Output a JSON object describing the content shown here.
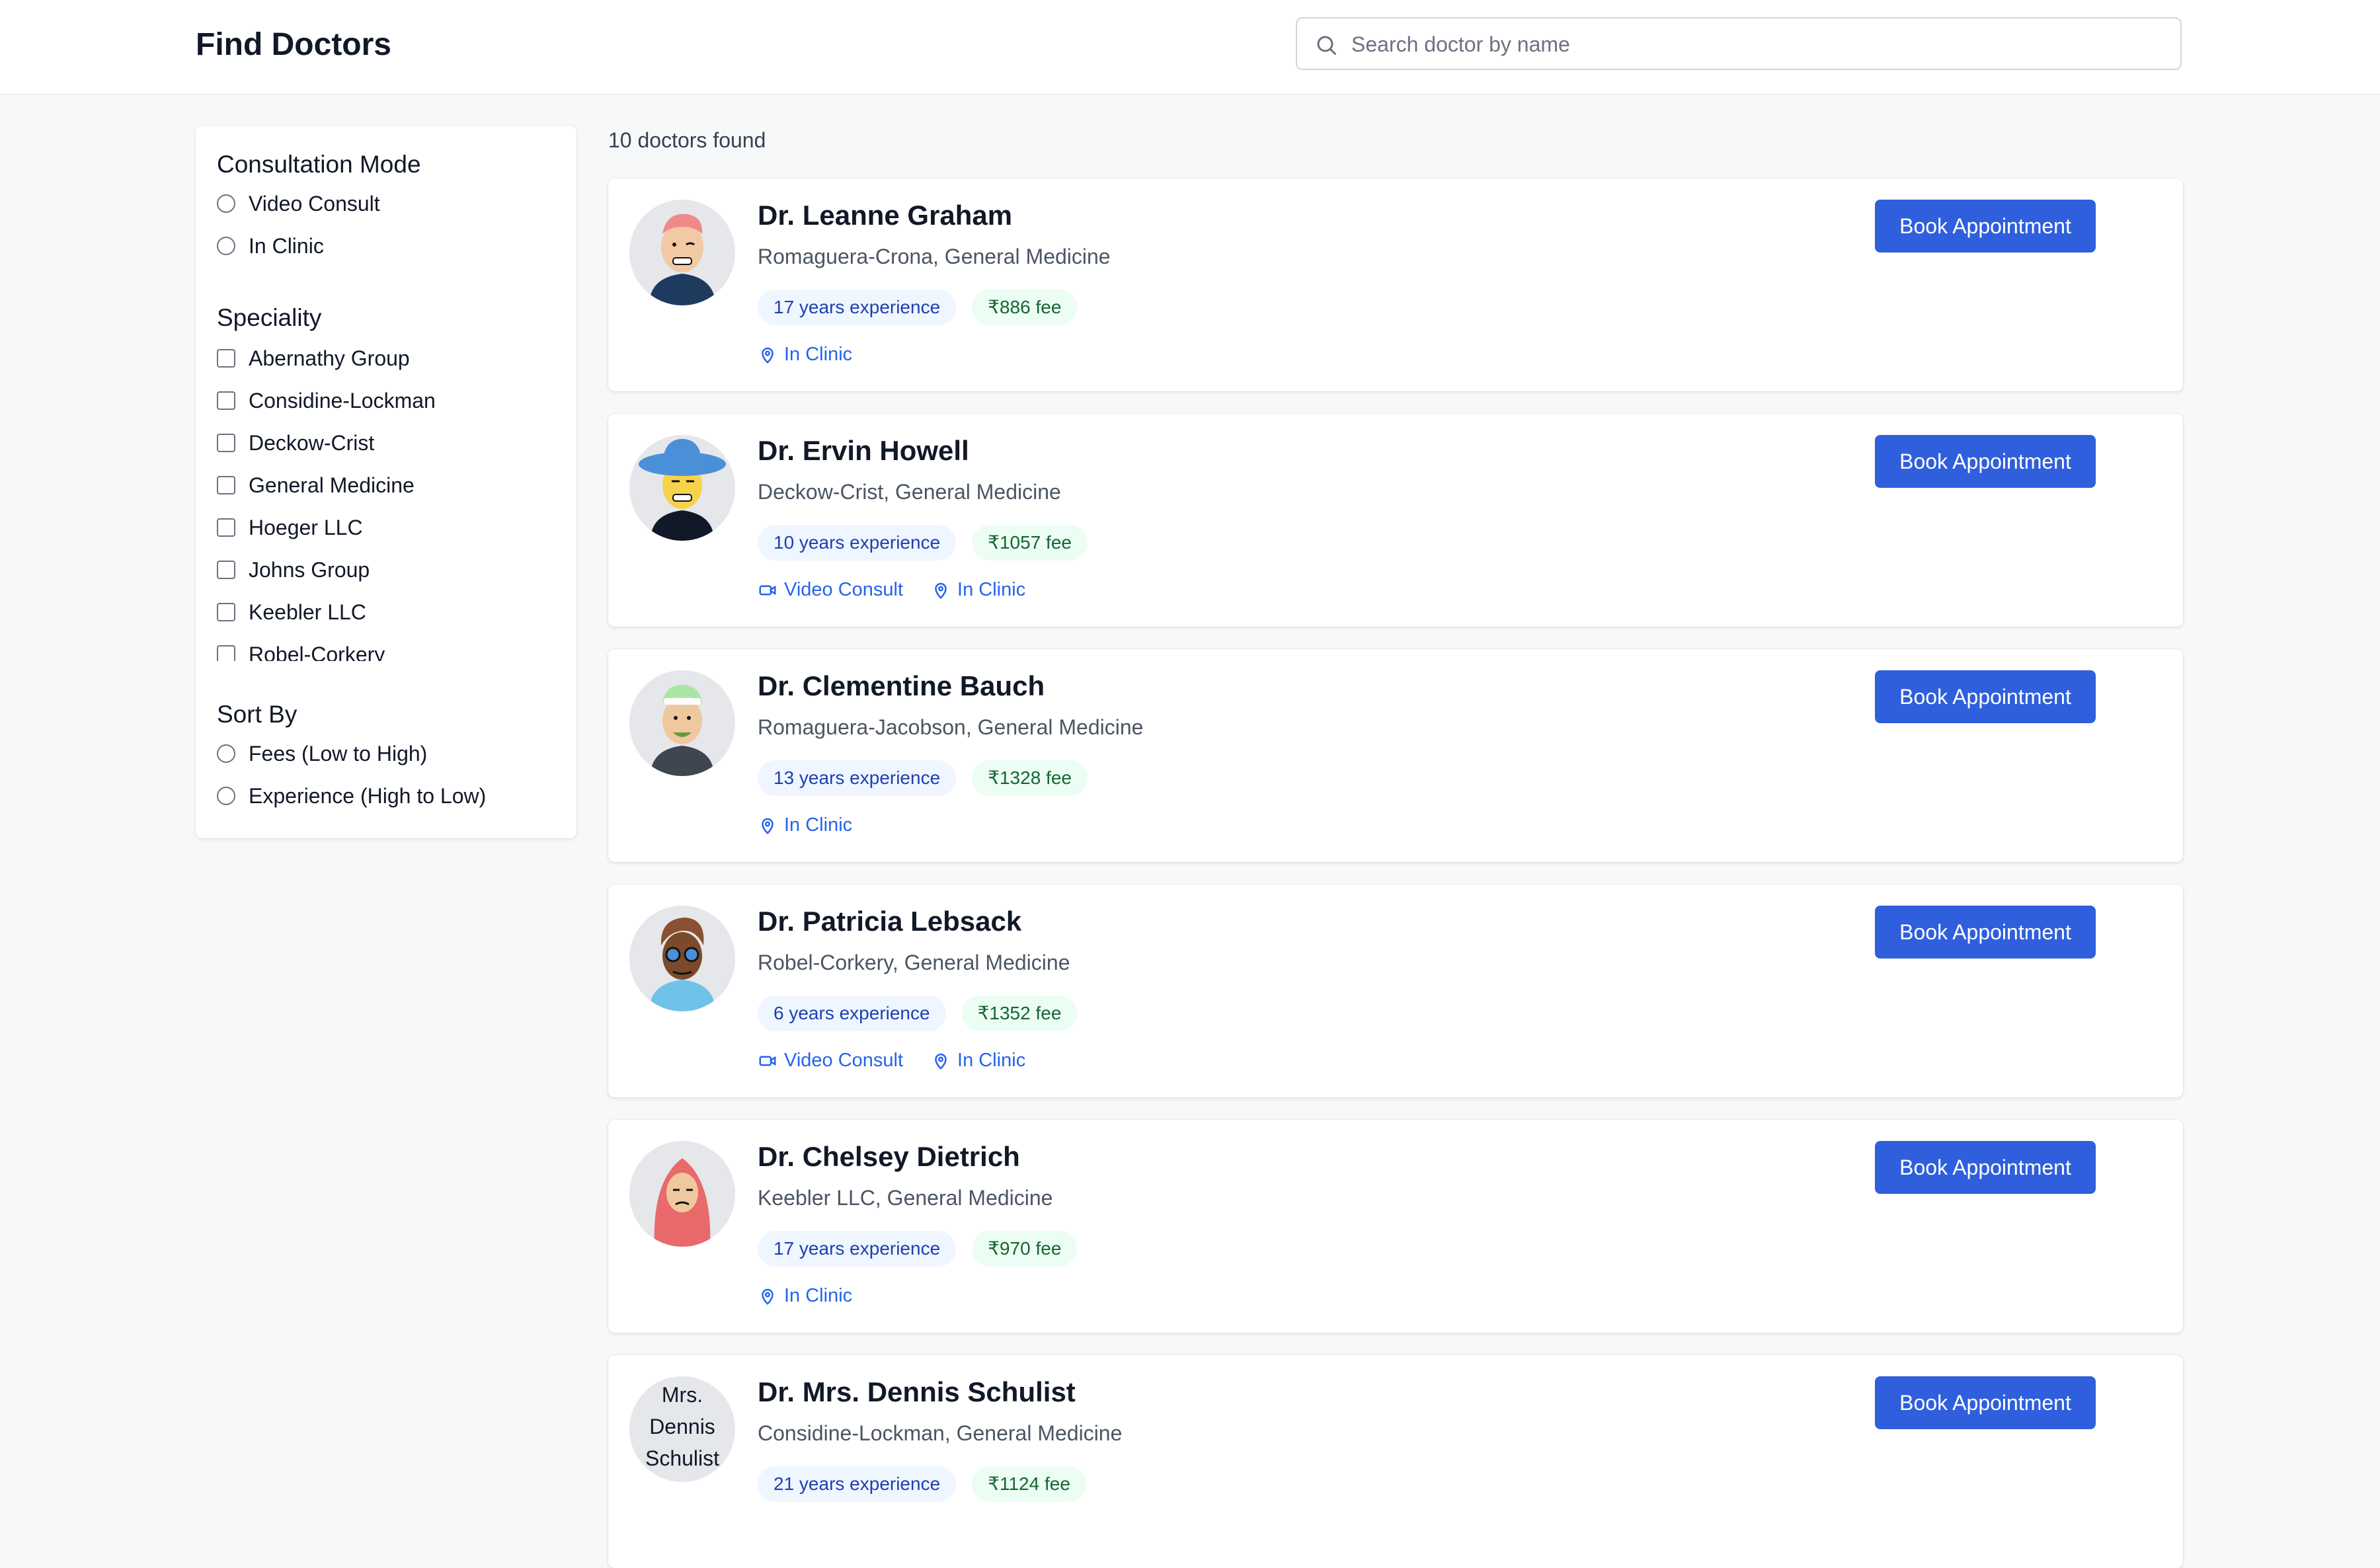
{
  "header": {
    "title": "Find Doctors",
    "search": {
      "placeholder": "Search doctor by name",
      "value": ""
    }
  },
  "filters": {
    "consultation": {
      "title": "Consultation Mode",
      "options": [
        "Video Consult",
        "In Clinic"
      ]
    },
    "speciality": {
      "title": "Speciality",
      "options": [
        "Abernathy Group",
        "Considine-Lockman",
        "Deckow-Crist",
        "General Medicine",
        "Hoeger LLC",
        "Johns Group",
        "Keebler LLC",
        "Robel-Corkery"
      ]
    },
    "sort": {
      "title": "Sort By",
      "options": [
        "Fees (Low to High)",
        "Experience (High to Low)"
      ]
    }
  },
  "results": {
    "count_text": "10 doctors found",
    "book_label": "Book Appointment",
    "doctors": [
      {
        "name": "Dr. Leanne Graham",
        "clinic": "Romaguera-Crona, General Medicine",
        "experience": "17 years experience",
        "fee": "₹886 fee",
        "modes": [
          "In Clinic"
        ]
      },
      {
        "name": "Dr. Ervin Howell",
        "clinic": "Deckow-Crist, General Medicine",
        "experience": "10 years experience",
        "fee": "₹1057 fee",
        "modes": [
          "Video Consult",
          "In Clinic"
        ]
      },
      {
        "name": "Dr. Clementine Bauch",
        "clinic": "Romaguera-Jacobson, General Medicine",
        "experience": "13 years experience",
        "fee": "₹1328 fee",
        "modes": [
          "In Clinic"
        ]
      },
      {
        "name": "Dr. Patricia Lebsack",
        "clinic": "Robel-Corkery, General Medicine",
        "experience": "6 years experience",
        "fee": "₹1352 fee",
        "modes": [
          "Video Consult",
          "In Clinic"
        ]
      },
      {
        "name": "Dr. Chelsey Dietrich",
        "clinic": "Keebler LLC, General Medicine",
        "experience": "17 years experience",
        "fee": "₹970 fee",
        "modes": [
          "In Clinic"
        ]
      },
      {
        "name": "Dr. Mrs. Dennis Schulist",
        "clinic": "Considine-Lockman, General Medicine",
        "experience": "21 years experience",
        "fee": "₹1124 fee",
        "modes": [],
        "avatar_alt": "Mrs. Dennis Schulist"
      }
    ]
  },
  "colors": {
    "primary": "#2f5fdc",
    "link": "#2563eb",
    "exp_bg": "#eff6ff",
    "fee_bg": "#ecfdf3"
  }
}
